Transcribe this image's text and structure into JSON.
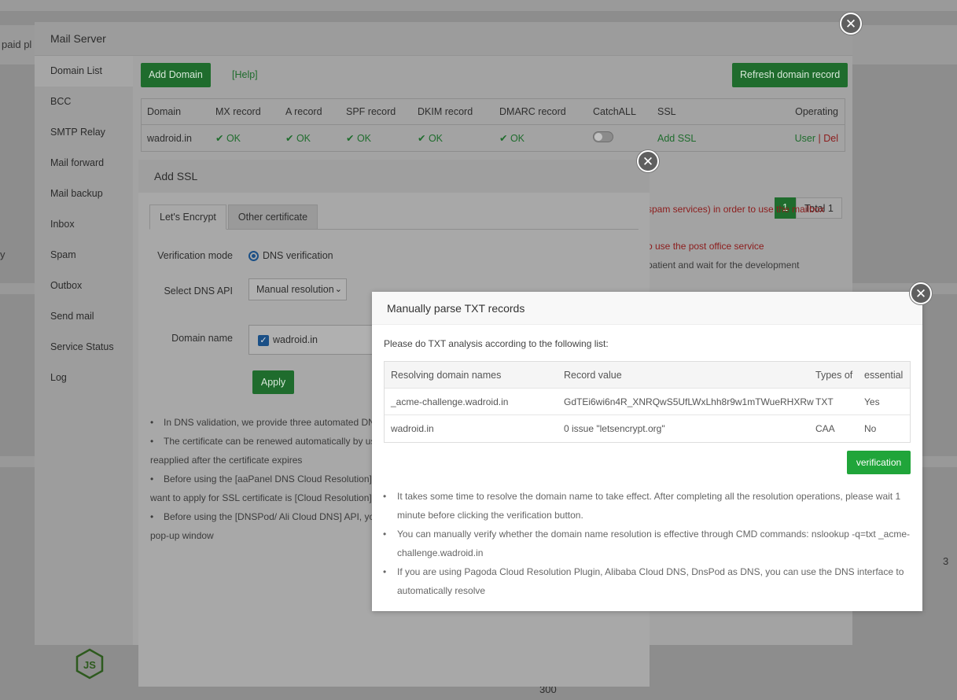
{
  "background": {
    "fragment_left": "paid pl",
    "fragment_edge": "y",
    "fragment_number": "300",
    "fragment_right": "3"
  },
  "mail_server": {
    "title": "Mail Server",
    "sidebar": [
      "Domain List",
      "BCC",
      "SMTP Relay",
      "Mail forward",
      "Mail backup",
      "Inbox",
      "Spam",
      "Outbox",
      "Send mail",
      "Service Status",
      "Log"
    ],
    "add_domain_label": "Add Domain",
    "help_label": "[Help]",
    "refresh_label": "Refresh domain record",
    "table": {
      "headers": [
        "Domain",
        "MX record",
        "A record",
        "SPF record",
        "DKIM record",
        "DMARC record",
        "CatchALL",
        "SSL",
        "Operating"
      ],
      "row": {
        "domain": "wadroid.in",
        "mx": "OK",
        "a": "OK",
        "spf": "OK",
        "dkim": "OK",
        "dmarc": "OK",
        "ssl": "Add SSL",
        "user": "User",
        "sep": "|",
        "del": "Del"
      }
    },
    "pager": {
      "current": "1",
      "total": "Total 1"
    },
    "notes": {
      "n1": "spam services) in order to use the mailbox",
      "n2": "o use the post office service",
      "n3": "patient and wait for the development"
    }
  },
  "add_ssl": {
    "title": "Add SSL",
    "tabs": [
      "Let's Encrypt",
      "Other certificate"
    ],
    "verification_mode_label": "Verification mode",
    "verification_mode_value": "DNS verification",
    "dns_api_label": "Select DNS API",
    "dns_api_value": "Manual resolution",
    "domain_label": "Domain name",
    "domain_value": "wadroid.in",
    "apply_label": "Apply",
    "notes": [
      "In DNS validation, we provide three automated DN",
      "The certificate can be renewed automatically by us",
      "reapplied after the certificate expires",
      "Before using the [aaPanel DNS Cloud Resolution] A",
      "want to apply for SSL certificate is [Cloud Resolution]",
      "Before using the [DNSPod/ Ali Cloud DNS] API, yo",
      "pop-up window"
    ]
  },
  "txt_dialog": {
    "title": "Manually parse TXT records",
    "intro": "Please do TXT analysis according to the following list:",
    "headers": [
      "Resolving domain names",
      "Record value",
      "Types of",
      "essential"
    ],
    "rows": [
      {
        "name": "_acme-challenge.wadroid.in",
        "value": "GdTEi6wi6n4R_XNRQwS5UfLWxLhh8r9w1mTWueRHXRw",
        "type": "TXT",
        "essential": "Yes"
      },
      {
        "name": "wadroid.in",
        "value": "0 issue \"letsencrypt.org\"",
        "type": "CAA",
        "essential": "No"
      }
    ],
    "verify_label": "verification",
    "notes": [
      "It takes some time to resolve the domain name to take effect. After completing all the resolution operations, please wait 1 minute before clicking the verification button.",
      "You can manually verify whether the domain name resolution is effective through CMD commands: nslookup -q=txt _acme-challenge.wadroid.in",
      "If you are using Pagoda Cloud Resolution Plugin, Alibaba Cloud DNS, DnsPod as DNS, you can use the DNS interface to automatically resolve"
    ]
  },
  "colors": {
    "overlay": "#8d8d8d",
    "green": "#20a53a",
    "dim_green": "#1f6c2d",
    "danger": "#8c1c1c"
  },
  "icons": {
    "close": "close-icon",
    "check": "checkmark-icon",
    "chevron": "chevron-down-icon",
    "node": "nodejs-logo"
  }
}
